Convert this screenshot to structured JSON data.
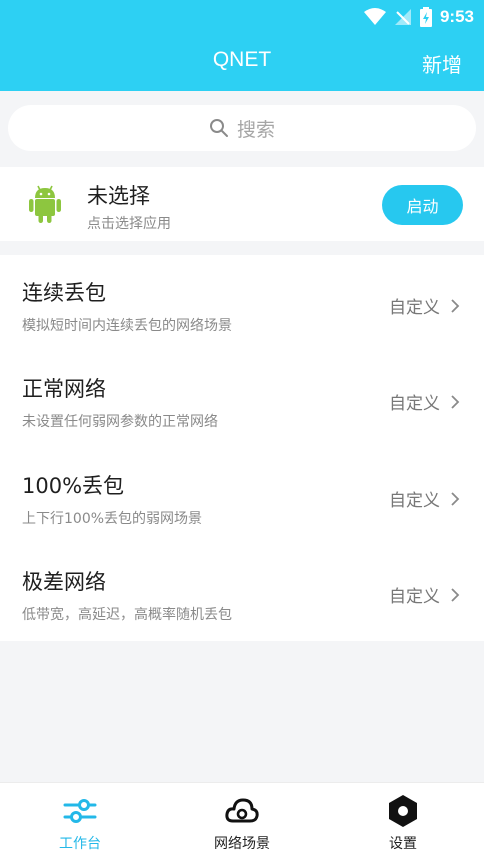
{
  "colors": {
    "primary": "#2dd0f3",
    "accent": "#27c8ef",
    "android_green": "#8dc63f"
  },
  "status_bar": {
    "time": "9:53",
    "icons": [
      "wifi-icon",
      "signal-icon",
      "battery-icon"
    ]
  },
  "app_bar": {
    "title": "QNET",
    "action_label": "新增"
  },
  "search": {
    "placeholder": "搜索",
    "icon": "search-icon"
  },
  "selected_app": {
    "name": "未选择",
    "hint": "点击选择应用",
    "start_label": "启动",
    "icon": "android-icon"
  },
  "scenarios": [
    {
      "title": "连续丢包",
      "description": "模拟短时间内连续丢包的网络场景",
      "action_label": "自定义"
    },
    {
      "title": "正常网络",
      "description": "未设置任何弱网参数的正常网络",
      "action_label": "自定义"
    },
    {
      "title": "100%丢包",
      "description": "上下行100%丢包的弱网场景",
      "action_label": "自定义"
    },
    {
      "title": "极差网络",
      "description": "低带宽，高延迟，高概率随机丢包",
      "action_label": "自定义"
    }
  ],
  "bottom_nav": {
    "items": [
      {
        "label": "工作台",
        "icon": "sliders-icon",
        "active": true
      },
      {
        "label": "网络场景",
        "icon": "cloud-icon",
        "active": false
      },
      {
        "label": "设置",
        "icon": "hexagon-settings-icon",
        "active": false
      }
    ]
  }
}
